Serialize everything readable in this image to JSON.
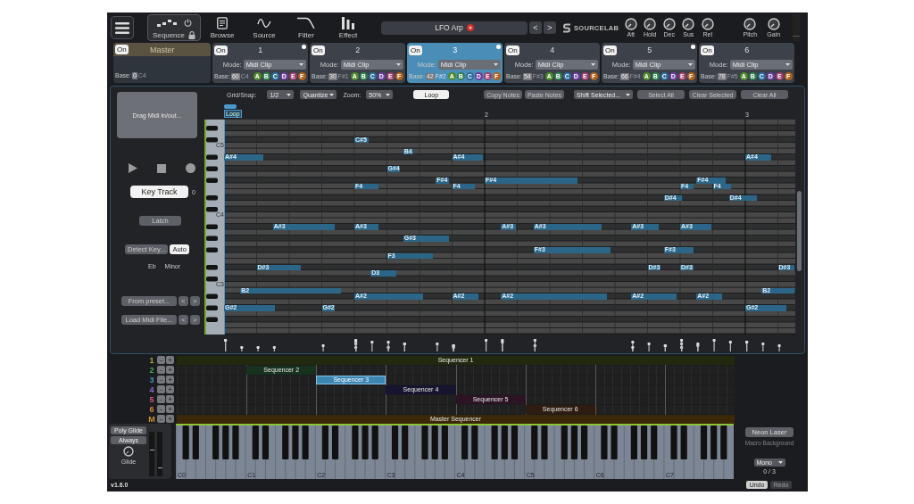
{
  "top_bar": {
    "tabs": [
      {
        "kind": "sequence",
        "label": "Sequence",
        "selected": true
      },
      {
        "kind": "browse",
        "label": "Browse",
        "selected": false
      },
      {
        "kind": "source",
        "label": "Source",
        "selected": false
      },
      {
        "kind": "filter",
        "label": "Filter",
        "selected": false
      },
      {
        "kind": "effect",
        "label": "Effect",
        "selected": false
      }
    ],
    "preset": {
      "name": "LFO Arp",
      "modified": true
    },
    "prev": "<",
    "next": ">",
    "logo": "SOURCELAB",
    "envelope_knobs": [
      {
        "label": "Att"
      },
      {
        "label": "Hold"
      },
      {
        "label": "Dec"
      },
      {
        "label": "Sus"
      },
      {
        "label": "Rel"
      }
    ],
    "output_knobs": [
      {
        "label": "Pitch"
      },
      {
        "label": "Gain"
      }
    ]
  },
  "sequencers": {
    "master": {
      "toggle": "On",
      "on": true,
      "title": "Master",
      "base_label": "Base:",
      "base": "0",
      "base_note": "C4"
    },
    "tracks": [
      {
        "toggle": "On",
        "on": true,
        "title": "1",
        "selected": false,
        "indicator": true,
        "mode_label": "Mode:",
        "mode": "Midi Clip",
        "base_label": "Base:",
        "base": "60",
        "base_note": "C4",
        "slots": [
          {
            "label": "A",
            "color": "#4e8a2c"
          },
          {
            "label": "B",
            "color": "#2f7f4c"
          },
          {
            "label": "C",
            "color": "#2c6b9c"
          },
          {
            "label": "D",
            "color": "#6a3c9c"
          },
          {
            "label": "E",
            "color": "#9c3c6c"
          },
          {
            "label": "F",
            "color": "#b0621e"
          }
        ]
      },
      {
        "toggle": "On",
        "on": true,
        "title": "2",
        "selected": false,
        "indicator": false,
        "mode_label": "Mode:",
        "mode": "Midi Clip",
        "base_label": "Base:",
        "base": "30",
        "base_note": "F#1",
        "slots": [
          {
            "label": "A",
            "color": "#4e8a2c"
          },
          {
            "label": "B",
            "color": "#2f7f4c"
          },
          {
            "label": "C",
            "color": "#2c6b9c"
          },
          {
            "label": "D",
            "color": "#6a3c9c"
          },
          {
            "label": "E",
            "color": "#9c3c6c"
          },
          {
            "label": "F",
            "color": "#b0621e"
          }
        ]
      },
      {
        "toggle": "On",
        "on": true,
        "title": "3",
        "selected": true,
        "indicator": true,
        "mode_label": "Mode:",
        "mode": "Midi Clip",
        "base_label": "Base:",
        "base": "42",
        "base_note": "F#2",
        "slots": [
          {
            "label": "A",
            "color": "#4e8a2c"
          },
          {
            "label": "B",
            "color": "#2f7f4c"
          },
          {
            "label": "C",
            "color": "#2c6b9c"
          },
          {
            "label": "D",
            "color": "#6a3c9c"
          },
          {
            "label": "E",
            "color": "#9c3c6c"
          },
          {
            "label": "F",
            "color": "#b0621e"
          }
        ]
      },
      {
        "toggle": "On",
        "on": true,
        "title": "4",
        "selected": false,
        "indicator": false,
        "mode_label": "Mode:",
        "mode": "Midi Clip",
        "base_label": "Base:",
        "base": "54",
        "base_note": "F#3",
        "slots": [
          {
            "label": "A",
            "color": "#4e8a2c"
          },
          {
            "label": "B",
            "color": "#2f7f4c"
          },
          {
            "label": "C",
            "color": "#2c6b9c"
          },
          {
            "label": "D",
            "color": "#6a3c9c"
          },
          {
            "label": "E",
            "color": "#9c3c6c"
          },
          {
            "label": "F",
            "color": "#b0621e"
          }
        ]
      },
      {
        "toggle": "On",
        "on": true,
        "title": "5",
        "selected": false,
        "indicator": true,
        "mode_label": "Mode:",
        "mode": "Midi Clip",
        "base_label": "Base:",
        "base": "66",
        "base_note": "F#4",
        "slots": [
          {
            "label": "A",
            "color": "#4e8a2c"
          },
          {
            "label": "B",
            "color": "#2f7f4c"
          },
          {
            "label": "C",
            "color": "#2c6b9c"
          },
          {
            "label": "D",
            "color": "#6a3c9c"
          },
          {
            "label": "E",
            "color": "#9c3c6c"
          },
          {
            "label": "F",
            "color": "#b0621e"
          }
        ]
      },
      {
        "toggle": "On",
        "on": true,
        "title": "6",
        "selected": false,
        "indicator": false,
        "mode_label": "Mode:",
        "mode": "Midi Clip",
        "base_label": "Base:",
        "base": "78",
        "base_note": "F#5",
        "slots": [
          {
            "label": "A",
            "color": "#4e8a2c"
          },
          {
            "label": "B",
            "color": "#2f7f4c"
          },
          {
            "label": "C",
            "color": "#2c6b9c"
          },
          {
            "label": "D",
            "color": "#6a3c9c"
          },
          {
            "label": "E",
            "color": "#9c3c6c"
          },
          {
            "label": "F",
            "color": "#b0621e"
          }
        ]
      }
    ]
  },
  "left_panel": {
    "drop_area": "Drag Midi in/out...",
    "key_track": {
      "label": "Key Track",
      "on": true
    },
    "key_track_value": "0",
    "latch": {
      "label": "Latch",
      "on": false
    },
    "detect_key": "Detect Key...",
    "auto": {
      "label": "Auto",
      "on": true
    },
    "key_root": "Eb",
    "key_scale": "Minor",
    "from_preset": {
      "label": "From preset...",
      "prev": "<",
      "next": ">"
    },
    "load_midi": {
      "label": "Load Midi File...",
      "prev": "<",
      "next": ">"
    }
  },
  "toolbar": {
    "grid_label": "Grid/Snap:",
    "grid_value": "1/2",
    "quantize": "Quantize",
    "zoom_label": "Zoom:",
    "zoom_value": "50%",
    "loop": {
      "label": "Loop",
      "on": true
    },
    "copy": "Copy Notes",
    "paste": "Paste Notes",
    "shift": "Shift Selected...",
    "actions": [
      "Select All",
      "Clear Selected",
      "Clear All"
    ]
  },
  "piano_roll": {
    "loop_marker": "Loop",
    "bar_labels": [
      "2",
      "3"
    ],
    "octave_labels": [
      "C5",
      "C4",
      "C3"
    ],
    "notes": [
      {
        "label": "C#5"
      },
      {
        "label": "B4"
      },
      {
        "label": "A#4"
      },
      {
        "label": "A#4"
      },
      {
        "label": "A#4"
      },
      {
        "label": "G#4"
      },
      {
        "label": "F#4"
      },
      {
        "label": "F#4"
      },
      {
        "label": "F#4"
      },
      {
        "label": "F4"
      },
      {
        "label": "F4"
      },
      {
        "label": "F4"
      },
      {
        "label": "F4"
      },
      {
        "label": "D#4"
      },
      {
        "label": "D#4"
      },
      {
        "label": "A#3"
      },
      {
        "label": "A#3"
      },
      {
        "label": "A#3"
      },
      {
        "label": "A#3"
      },
      {
        "label": "A#3"
      },
      {
        "label": "A#3"
      },
      {
        "label": "G#3"
      },
      {
        "label": "F#3"
      },
      {
        "label": "F#3"
      },
      {
        "label": "F3"
      },
      {
        "label": "D#3"
      },
      {
        "label": "D#3"
      },
      {
        "label": "D#3"
      },
      {
        "label": "D#3"
      },
      {
        "label": "D3"
      },
      {
        "label": "B2"
      },
      {
        "label": "B2"
      },
      {
        "label": "A#2"
      },
      {
        "label": "A#2"
      },
      {
        "label": "A#2"
      },
      {
        "label": "A#2"
      },
      {
        "label": "A#2"
      },
      {
        "label": "G#2"
      },
      {
        "label": "G#2"
      },
      {
        "label": "G#2"
      }
    ]
  },
  "arrangement": {
    "rows": [
      {
        "number": "1",
        "color": "#a8a838",
        "minus": "-",
        "plus": "+",
        "clip": {
          "label": "Sequencer 1",
          "selected": false,
          "color": "#23290f"
        }
      },
      {
        "number": "2",
        "color": "#4caa4c",
        "minus": "-",
        "plus": "+",
        "clip": {
          "label": "Sequencer 2",
          "selected": false,
          "color": "#173320"
        }
      },
      {
        "number": "3",
        "color": "#4a90c0",
        "minus": "-",
        "plus": "+",
        "clip": {
          "label": "Sequencer 3",
          "selected": true,
          "color": "#3d86b4"
        }
      },
      {
        "number": "4",
        "color": "#8a6ad0",
        "minus": "-",
        "plus": "+",
        "clip": {
          "label": "Sequencer 4",
          "selected": false,
          "color": "#16142e"
        }
      },
      {
        "number": "5",
        "color": "#d05a8a",
        "minus": "-",
        "plus": "+",
        "clip": {
          "label": "Sequencer 5",
          "selected": false,
          "color": "#2c1424"
        }
      },
      {
        "number": "6",
        "color": "#d08a3a",
        "minus": "-",
        "plus": "+",
        "clip": {
          "label": "Sequencer 6",
          "selected": false,
          "color": "#2e1c10"
        }
      },
      {
        "number": "M",
        "color": "#d0902a",
        "minus": "-",
        "plus": "+",
        "clip": {
          "label": "Master Sequencer",
          "selected": false,
          "color": "#3b2808"
        }
      }
    ]
  },
  "keyboard": {
    "poly_glide": "Poly Glide",
    "always": "Always",
    "glide_label": "Glide",
    "octave_labels": [
      "C0",
      "C1",
      "C2",
      "C3",
      "C4",
      "C5",
      "C6",
      "C7"
    ],
    "preset_button": "Neon Laser",
    "macro_background": {
      "label": "Macro Background",
      "disabled": true
    },
    "voice_mode": "Mono",
    "voice_count": "0 / 3"
  },
  "footer": {
    "version": "v1.6.0",
    "undo": {
      "label": "Undo",
      "disabled": false
    },
    "redo": {
      "label": "Redo",
      "disabled": true
    }
  }
}
